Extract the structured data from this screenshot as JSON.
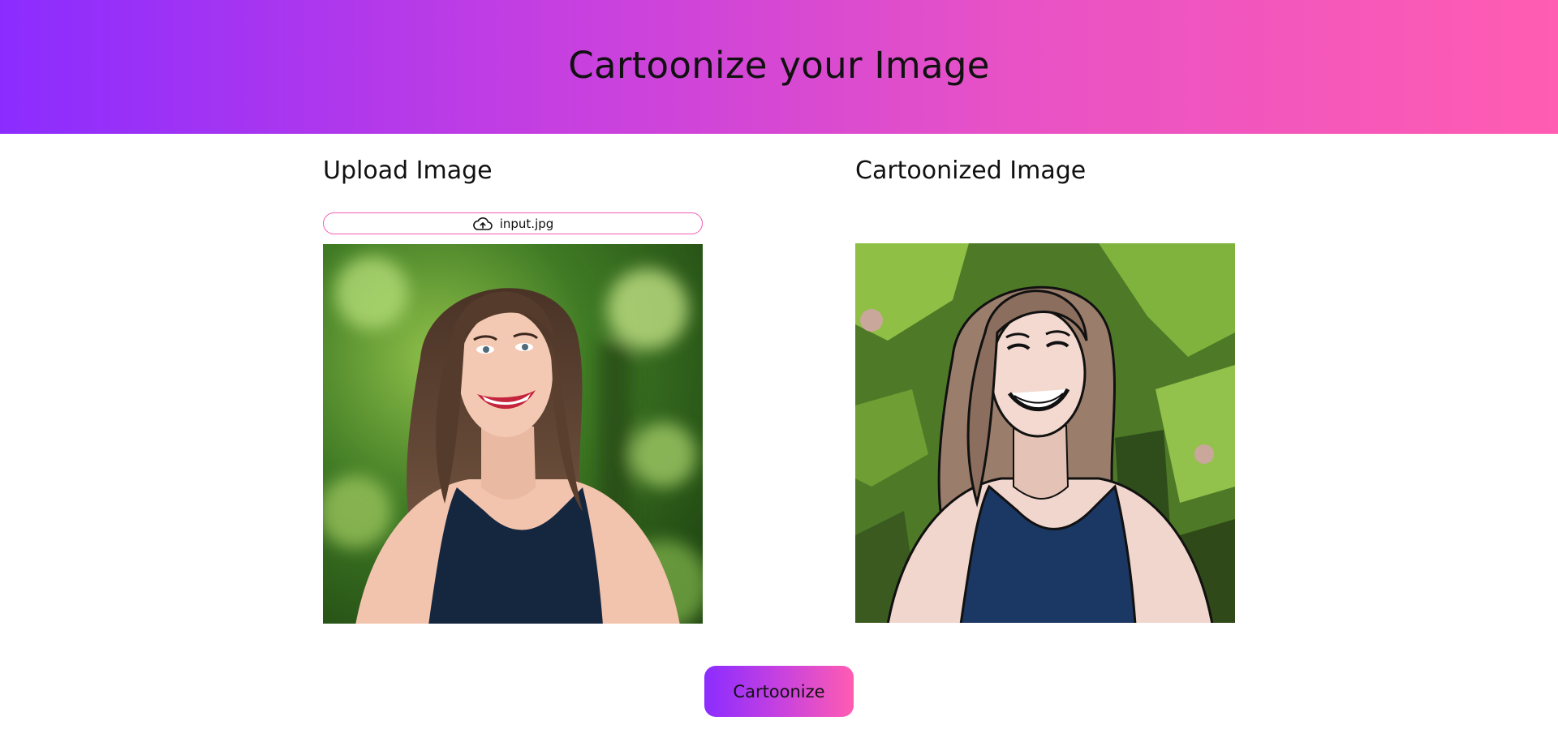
{
  "header": {
    "title": "Cartoonize your Image"
  },
  "upload": {
    "title": "Upload Image",
    "file_name": "input.jpg",
    "file_icon": "cloud-upload-icon",
    "image_description": "photo-woman-smiling-outdoors"
  },
  "result": {
    "title": "Cartoonized Image",
    "image_description": "cartoon-woman-smiling-outdoors"
  },
  "actions": {
    "cartoonize_label": "Cartoonize"
  },
  "colors": {
    "gradient_start": "#8b2cff",
    "gradient_end": "#ff5cb2",
    "pill_border": "#f25bb4"
  }
}
